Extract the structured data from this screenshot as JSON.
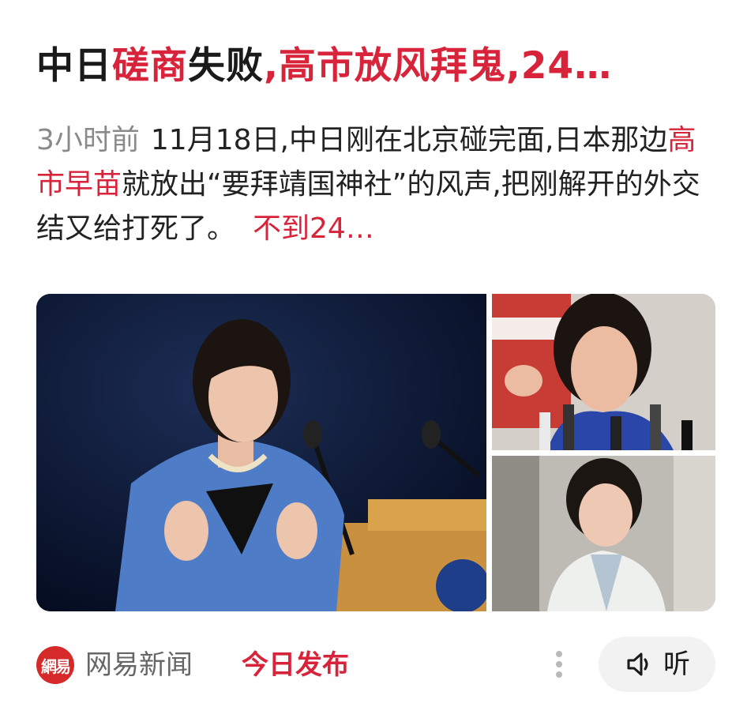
{
  "article": {
    "title_parts": [
      {
        "text": "中日",
        "highlight": false
      },
      {
        "text": "磋商",
        "highlight": true
      },
      {
        "text": "失败",
        "highlight": false
      },
      {
        "text": ",高市放风拜鬼,24…",
        "highlight": true
      }
    ],
    "time": "3小时前",
    "summary_parts": [
      {
        "text": "11月18日,中日刚在北京碰完面,日本那边",
        "highlight": false
      },
      {
        "text": "高市早苗",
        "highlight": true
      },
      {
        "text": "就放出“要拜靖国神社”的风声,把刚解开的外交结又给打死了。",
        "highlight": false
      }
    ],
    "more_text": "不到24…",
    "highlight_color": "#d8243b",
    "images": {
      "main": "photo-woman-speaking-at-podium",
      "top_right": "photo-woman-at-press-microphones",
      "bottom_right": "photo-woman-smiling-in-light-jacket"
    }
  },
  "footer": {
    "logo_text": "網易",
    "source": "网易新闻",
    "tag": "今日发布",
    "more_icon": "vertical-dots-icon",
    "listen_icon": "speaker-icon",
    "listen_label": "听"
  }
}
